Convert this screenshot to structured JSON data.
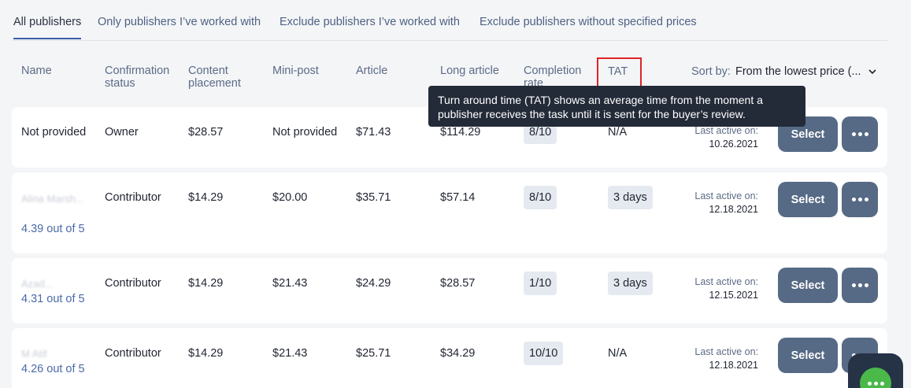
{
  "tabs": [
    {
      "label": "All publishers"
    },
    {
      "label": "Only publishers I’ve worked with"
    },
    {
      "label": "Exclude publishers I’ve worked with"
    },
    {
      "label": "Exclude publishers without specified prices"
    }
  ],
  "columns": {
    "name": "Name",
    "confirmation_line1": "Confirmation",
    "confirmation_line2": "status",
    "content_line1": "Content",
    "content_line2": "placement",
    "mini_post": "Mini-post",
    "article": "Article",
    "long_article": "Long article",
    "completion_line1": "Completion",
    "completion_line2": "rate",
    "tat": "TAT"
  },
  "sort": {
    "label": "Sort by:",
    "value": "From the lowest price (..."
  },
  "tooltip": {
    "text": "Turn around time (TAT) shows an average time from the moment a publisher receives the task until it is sent for the buyer’s review."
  },
  "rows": [
    {
      "name": "Not provided",
      "rating": "",
      "status": "Owner",
      "content": "$28.57",
      "mini_post": "Not provided",
      "article": "$71.43",
      "long_article": "$114.29",
      "completion": "8/10",
      "tat": "N/A",
      "active_label": "Last active on:",
      "active_date": "10.26.2021",
      "select_label": "Select"
    },
    {
      "name": "Alina Marsh...",
      "rating": "4.39 out of 5",
      "status": "Contributor",
      "content": "$14.29",
      "mini_post": "$20.00",
      "article": "$35.71",
      "long_article": "$57.14",
      "completion": "8/10",
      "tat": "3 days",
      "active_label": "Last active on:",
      "active_date": "12.18.2021",
      "select_label": "Select"
    },
    {
      "name": "Azad...",
      "rating": "4.31 out of 5",
      "status": "Contributor",
      "content": "$14.29",
      "mini_post": "$21.43",
      "article": "$24.29",
      "long_article": "$28.57",
      "completion": "1/10",
      "tat": "3 days",
      "active_label": "Last active on:",
      "active_date": "12.15.2021",
      "select_label": "Select"
    },
    {
      "name": "M Atif",
      "rating": "4.26 out of 5",
      "status": "Contributor",
      "content": "$14.29",
      "mini_post": "$21.43",
      "article": "$25.71",
      "long_article": "$34.29",
      "completion": "10/10",
      "tat": "N/A",
      "active_label": "Last active on:",
      "active_date": "12.18.2021",
      "select_label": "Select"
    }
  ],
  "colors": {
    "accent": "#3a5ca8",
    "button": "#566a85",
    "tooltip_bg": "#232a38",
    "chat": "#4bb84a",
    "highlight_box": "#e02424"
  },
  "icons": {
    "more": "more-dots-icon",
    "sort": "chevron-down-icon",
    "chat": "chat-icon"
  }
}
